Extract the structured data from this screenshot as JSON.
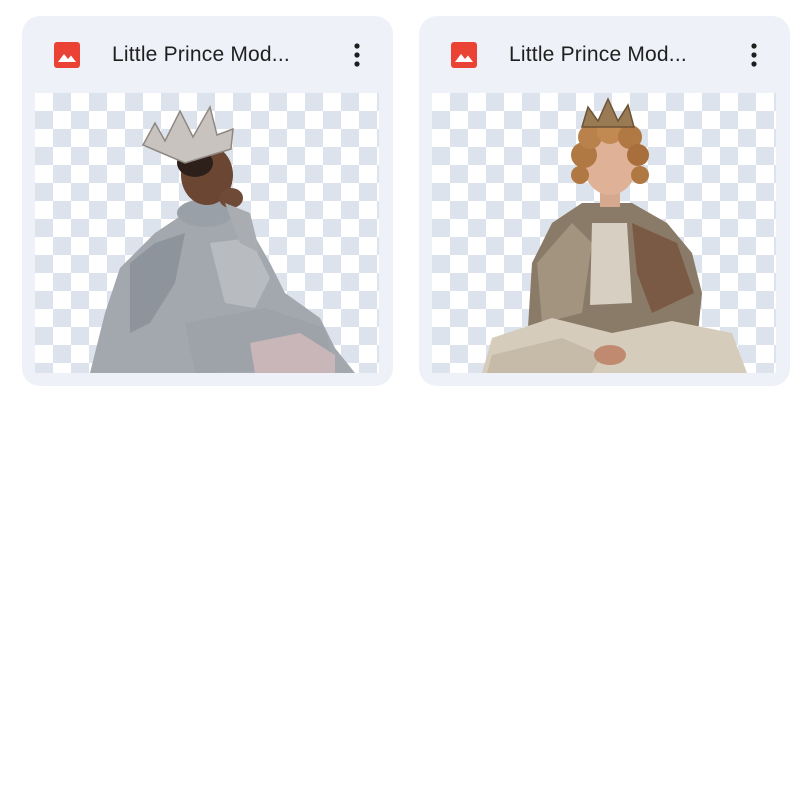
{
  "files": [
    {
      "title": "Little Prince Mod...",
      "icon": "image-file-icon",
      "icon_color": "#ea4335",
      "thumbnail": "boy-in-gray-outfit-wearing-crown-photo",
      "menu_icon": "more-vert-icon"
    },
    {
      "title": "Little Prince Mod...",
      "icon": "image-file-icon",
      "icon_color": "#ea4335",
      "thumbnail": "curly-haired-boy-in-rustic-outfit-wearing-crown-photo",
      "menu_icon": "more-vert-icon"
    }
  ]
}
